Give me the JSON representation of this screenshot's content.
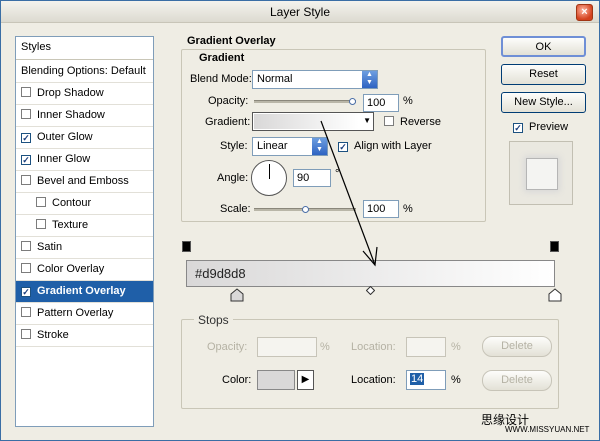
{
  "window": {
    "title": "Layer Style",
    "close_glyph": "×"
  },
  "styles_panel": {
    "header": "Styles",
    "items": [
      {
        "label": "Blending Options: Default",
        "checkbox": false,
        "checked": false,
        "indent": false,
        "selected": false
      },
      {
        "label": "Drop Shadow",
        "checkbox": true,
        "checked": false,
        "indent": false,
        "selected": false
      },
      {
        "label": "Inner Shadow",
        "checkbox": true,
        "checked": false,
        "indent": false,
        "selected": false
      },
      {
        "label": "Outer Glow",
        "checkbox": true,
        "checked": true,
        "indent": false,
        "selected": false
      },
      {
        "label": "Inner Glow",
        "checkbox": true,
        "checked": true,
        "indent": false,
        "selected": false
      },
      {
        "label": "Bevel and Emboss",
        "checkbox": true,
        "checked": false,
        "indent": false,
        "selected": false
      },
      {
        "label": "Contour",
        "checkbox": true,
        "checked": false,
        "indent": true,
        "selected": false
      },
      {
        "label": "Texture",
        "checkbox": true,
        "checked": false,
        "indent": true,
        "selected": false
      },
      {
        "label": "Satin",
        "checkbox": true,
        "checked": false,
        "indent": false,
        "selected": false
      },
      {
        "label": "Color Overlay",
        "checkbox": true,
        "checked": false,
        "indent": false,
        "selected": false
      },
      {
        "label": "Gradient Overlay",
        "checkbox": true,
        "checked": true,
        "indent": false,
        "selected": true
      },
      {
        "label": "Pattern Overlay",
        "checkbox": true,
        "checked": false,
        "indent": false,
        "selected": false
      },
      {
        "label": "Stroke",
        "checkbox": true,
        "checked": false,
        "indent": false,
        "selected": false
      }
    ]
  },
  "gradient_overlay": {
    "section_title": "Gradient Overlay",
    "group_title": "Gradient",
    "blend_mode_label": "Blend Mode:",
    "blend_mode_value": "Normal",
    "opacity_label": "Opacity:",
    "opacity_value": "100",
    "opacity_unit": "%",
    "opacity_level": 1.0,
    "gradient_label": "Gradient:",
    "reverse_label": "Reverse",
    "reverse_checked": false,
    "style_label": "Style:",
    "style_value": "Linear",
    "align_label": "Align with Layer",
    "align_checked": true,
    "angle_label": "Angle:",
    "angle_value": "90",
    "angle_unit": "°",
    "scale_label": "Scale:",
    "scale_value": "100",
    "scale_unit": "%",
    "scale_level": 0.5
  },
  "buttons": {
    "ok": "OK",
    "reset": "Reset",
    "new_style": "New Style...",
    "preview_label": "Preview",
    "preview_checked": true
  },
  "gradient_editor": {
    "color_hex_label": "#d9d8d8",
    "start_color": "#d9d8d8",
    "end_color": "#ffffff",
    "stops_title": "Stops",
    "opacity_label": "Opacity:",
    "opacity_unit": "%",
    "location_label": "Location:",
    "location_unit": "%",
    "delete_label": "Delete",
    "color_label": "Color:",
    "color_location_label": "Location:",
    "color_location_value": "14",
    "color_location_unit": "%",
    "delete2_label": "Delete"
  },
  "watermark": {
    "line1": "思缘设计",
    "line2": "WWW.MISSYUAN.NET"
  }
}
